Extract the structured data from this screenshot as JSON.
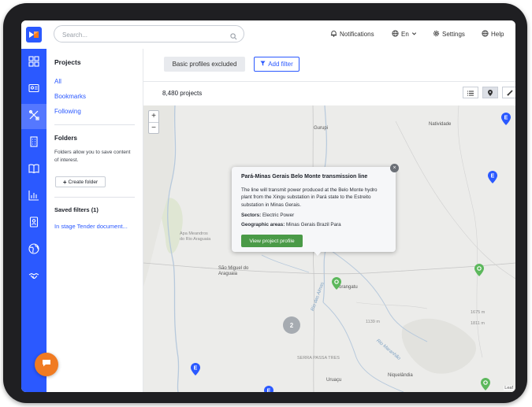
{
  "search": {
    "placeholder": "Search..."
  },
  "topnav": {
    "notifications": "Notifications",
    "language": "En",
    "settings": "Settings",
    "help": "Help"
  },
  "panel": {
    "projects_title": "Projects",
    "all": "All",
    "bookmarks": "Bookmarks",
    "following": "Following",
    "folders_title": "Folders",
    "folders_text": "Folders allow you to save content of interest.",
    "create_folder": "Create folder",
    "saved_filters": "Saved filters (1)",
    "saved_filter_item": "In stage Tender document..."
  },
  "filters": {
    "basic_profiles": "Basic profiles excluded",
    "add_filter": "Add filter"
  },
  "results": {
    "count": "8,480 projects"
  },
  "map": {
    "zoom_in": "+",
    "zoom_out": "−",
    "cluster_count": "2",
    "labels": {
      "gurupi": "Gurupi",
      "natividade": "Natividade",
      "apa": "Apa Meandros do Rio Araguaia",
      "sao_miguel": "São Miguel do Araguaia",
      "porangatu": "Porangatu",
      "rio_das_almas": "Rio das Almas",
      "rio_maranhao": "Rio Maranhão",
      "serra": "SERRA PASSA TRES",
      "uruacu": "Uruaçu",
      "niquelandia": "Niquelândia",
      "elev1": "1139 m",
      "elev2": "1675 m",
      "elev3": "1811 m",
      "attribution": "Leaf"
    }
  },
  "popup": {
    "title": "Pará-Minas Gerais Belo Monte transmission line",
    "description": "The line will transmit power produced at the Belo Monte hydro plant from the Xingu substation in Pará state to the Estreito substation in Minas Gerais.",
    "sectors_label": "Sectors:",
    "sectors_value": "Electric Power",
    "geo_label": "Geographic areas:",
    "geo_value": "Minas Gerais Brazil Para",
    "button": "View project profile",
    "close": "×"
  },
  "colors": {
    "brand_blue": "#2b59ff",
    "pin_blue": "#2b59ff",
    "pin_green": "#5cb85c",
    "button_green": "#4a9a47",
    "chat_orange": "#f07b22"
  },
  "icons": {
    "sidebar": [
      "dashboard-icon",
      "profile-card-icon",
      "tools-icon",
      "building-icon",
      "book-icon",
      "chart-icon",
      "contact-icon",
      "globe-icon",
      "handshake-icon"
    ]
  }
}
